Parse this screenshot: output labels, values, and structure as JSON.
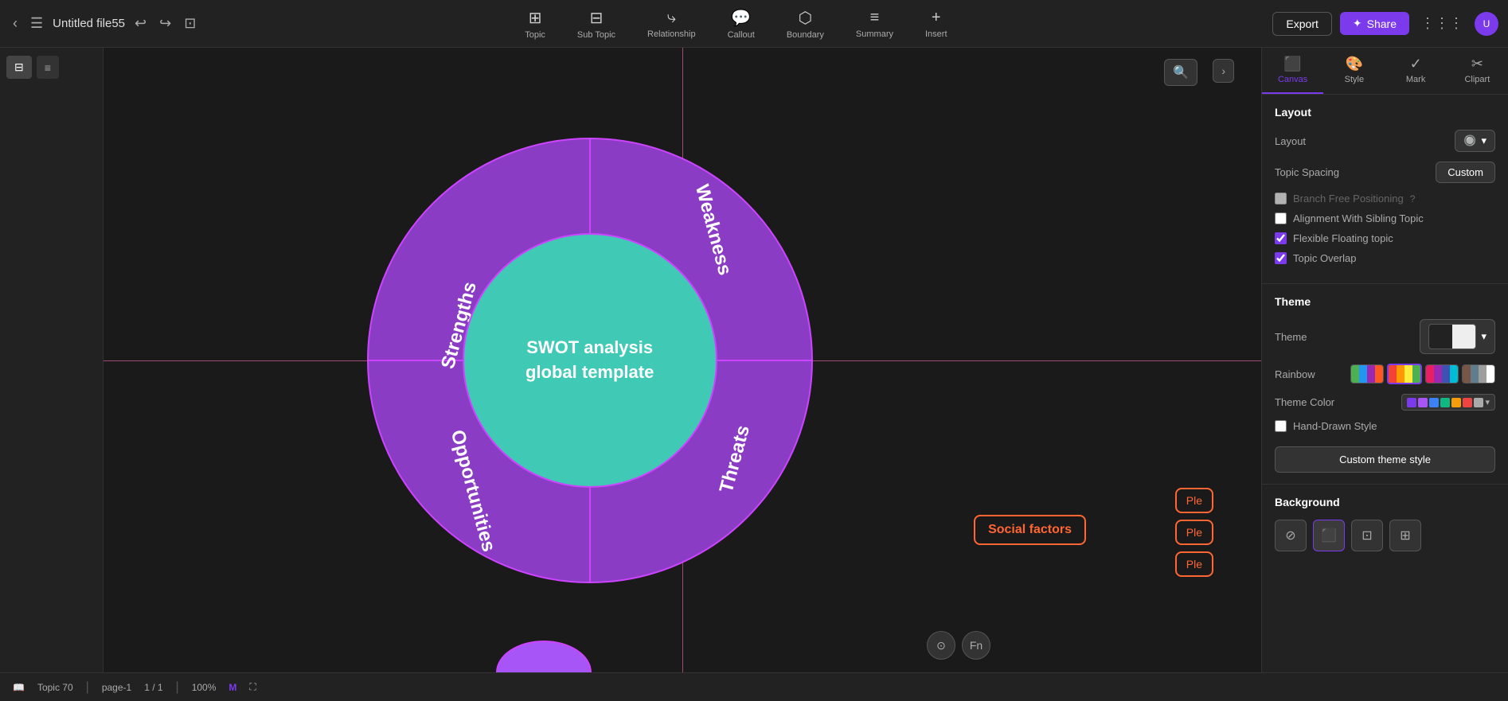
{
  "header": {
    "back_label": "‹",
    "menu_label": "☰",
    "file_title": "Untitled file55",
    "undo_label": "↩",
    "redo_label": "↪",
    "publish_label": "⊡",
    "export_label": "Export",
    "share_label": "Share",
    "grid_label": "⋮⋮⋮",
    "toolbar_items": [
      {
        "id": "topic",
        "icon": "⊞",
        "label": "Topic"
      },
      {
        "id": "subtopic",
        "icon": "⊟",
        "label": "Sub Topic"
      },
      {
        "id": "relationship",
        "icon": "⤷",
        "label": "Relationship"
      },
      {
        "id": "callout",
        "icon": "💬",
        "label": "Callout"
      },
      {
        "id": "boundary",
        "icon": "⬡",
        "label": "Boundary"
      },
      {
        "id": "summary",
        "icon": "≡",
        "label": "Summary"
      },
      {
        "id": "insert",
        "icon": "+",
        "label": "Insert"
      }
    ]
  },
  "canvas": {
    "search_placeholder": "🔍",
    "swot": {
      "center_line1": "SWOT analysis",
      "center_line2": "global template",
      "strengths": "Strengths",
      "weakness": "Weakness",
      "opportunities": "Opportunities",
      "threats": "Threats"
    },
    "social_factors_label": "Social factors",
    "ple_labels": [
      "Ple",
      "Ple",
      "Ple"
    ]
  },
  "right_panel": {
    "tabs": [
      {
        "id": "canvas",
        "icon": "⬛",
        "label": "Canvas"
      },
      {
        "id": "style",
        "icon": "🎨",
        "label": "Style"
      },
      {
        "id": "mark",
        "icon": "✓",
        "label": "Mark"
      },
      {
        "id": "clipart",
        "icon": "✂",
        "label": "Clipart"
      }
    ],
    "layout_section": {
      "title": "Layout",
      "layout_label": "Layout",
      "topic_spacing_label": "Topic Spacing",
      "topic_spacing_value": "Custom",
      "branch_free_label": "Branch Free Positioning",
      "alignment_label": "Alignment With Sibling Topic",
      "flexible_label": "Flexible Floating topic",
      "topic_overlap_label": "Topic Overlap",
      "alignment_checked": false,
      "flexible_checked": true,
      "overlap_checked": true
    },
    "theme_section": {
      "title": "Theme",
      "theme_label": "Theme",
      "rainbow_label": "Rainbow",
      "theme_color_label": "Theme Color",
      "hand_drawn_label": "Hand-Drawn Style",
      "hand_drawn_checked": false,
      "custom_theme_label": "Custom theme style"
    },
    "background_section": {
      "title": "Background"
    }
  },
  "status_bar": {
    "book_icon": "📖",
    "topic_count": "Topic 70",
    "page_label": "page-1",
    "page_info": "1 / 1",
    "zoom_level": "100%",
    "brand_icon": "M",
    "expand_icon": "⛶"
  },
  "rainbow_swatches": [
    {
      "colors": [
        "#4CAF50",
        "#2196F3",
        "#9C27B0",
        "#FF5722"
      ],
      "active": false
    },
    {
      "colors": [
        "#F44336",
        "#FF9800",
        "#FFEB3B",
        "#4CAF50"
      ],
      "active": true
    },
    {
      "colors": [
        "#E91E63",
        "#9C27B0",
        "#3F51B5",
        "#00BCD4"
      ],
      "active": false
    },
    {
      "colors": [
        "#795548",
        "#607D8B",
        "#9E9E9E",
        "#FFFFFF"
      ],
      "active": false
    }
  ],
  "theme_colors": [
    "#7c3aed",
    "#3b82f6",
    "#10b981",
    "#f59e0b",
    "#ef4444",
    "#ec4899",
    "#aaa"
  ]
}
